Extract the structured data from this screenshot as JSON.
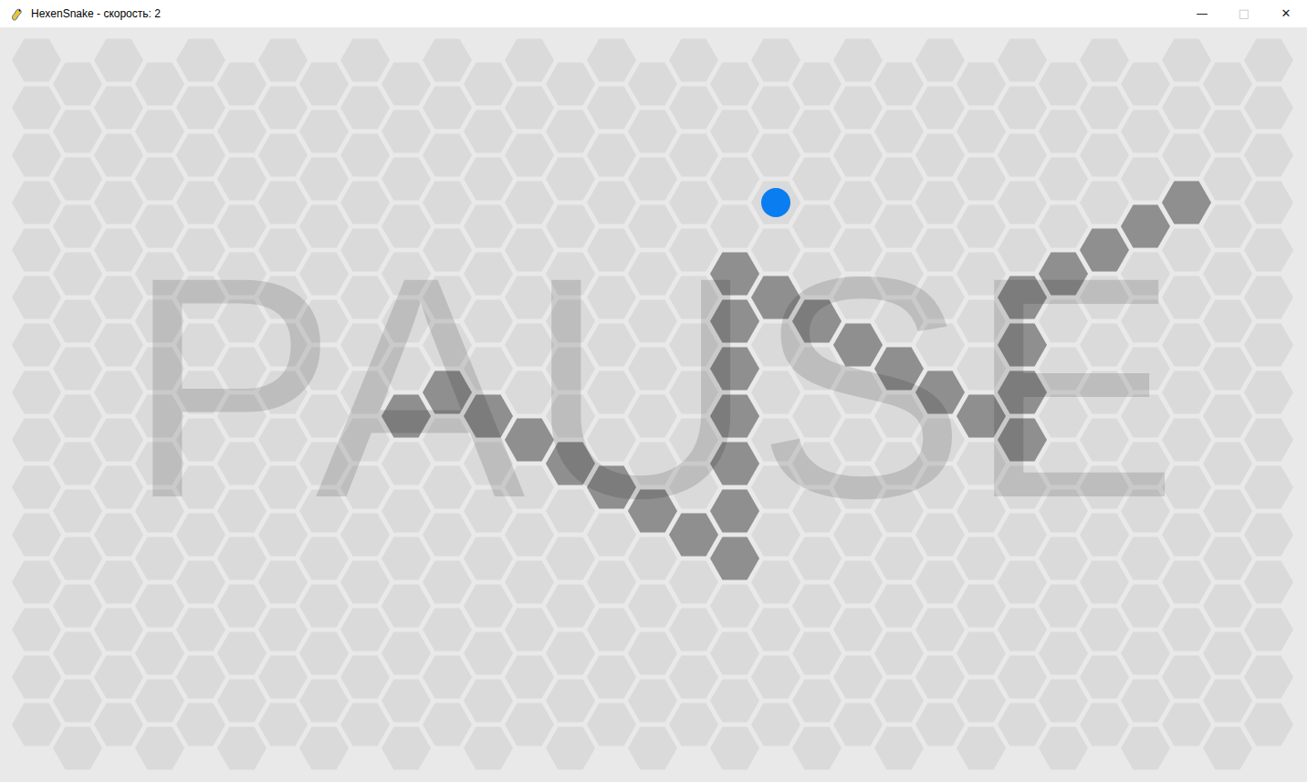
{
  "window": {
    "title": "HexenSnake - скорость: 2",
    "controls": [
      {
        "label": "—",
        "disabled": false
      },
      {
        "label": "□",
        "disabled": true
      },
      {
        "label": "✕",
        "disabled": false
      }
    ]
  },
  "board": {
    "columns": 31,
    "rows": 15,
    "snake": [
      [
        9,
        7
      ],
      [
        10,
        7
      ],
      [
        11,
        7
      ],
      [
        12,
        8
      ],
      [
        13,
        8
      ],
      [
        14,
        9
      ],
      [
        15,
        9
      ],
      [
        16,
        10
      ],
      [
        17,
        10
      ],
      [
        17,
        9
      ],
      [
        17,
        8
      ],
      [
        17,
        7
      ],
      [
        17,
        6
      ],
      [
        17,
        5
      ],
      [
        17,
        4
      ],
      [
        18,
        5
      ],
      [
        19,
        5
      ],
      [
        20,
        6
      ],
      [
        21,
        6
      ],
      [
        22,
        7
      ],
      [
        23,
        7
      ],
      [
        24,
        7
      ],
      [
        24,
        8
      ],
      [
        24,
        6
      ],
      [
        24,
        5
      ],
      [
        25,
        4
      ],
      [
        26,
        4
      ],
      [
        27,
        3
      ],
      [
        28,
        3
      ]
    ],
    "food": [
      18,
      3
    ],
    "overlay_text": "PAUSE"
  }
}
